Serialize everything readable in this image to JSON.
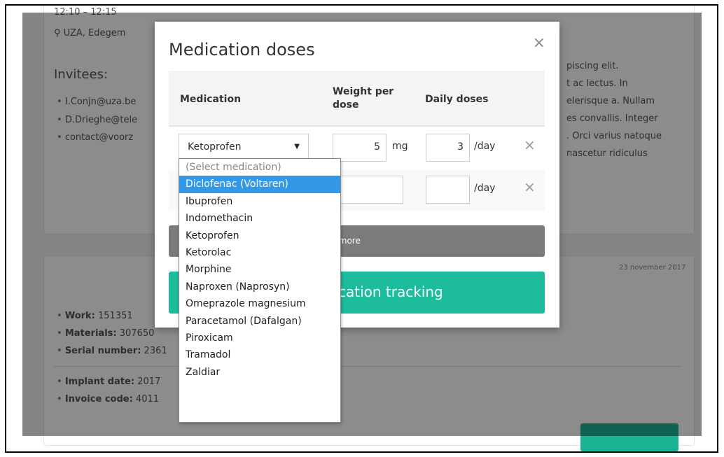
{
  "background": {
    "time_text": "12:10 – 12:15",
    "location_text": "UZA, Edegem",
    "invitees_heading": "Invitees:",
    "invitees": [
      "I.Conjn@uza.be",
      "D.Drieghe@tele",
      "contact@voorz"
    ],
    "lorem_lines": [
      "piscing elit.",
      "t ac lectus. In",
      "elerisque a. Nullam",
      "es convallis. Integer",
      ". Orci varius natoque",
      "nascetur ridiculus"
    ],
    "date_text": "23 november 2017",
    "details": [
      {
        "label": "Work:",
        "value": "151351"
      },
      {
        "label": "Materials:",
        "value": "307650"
      },
      {
        "label": "Serial number:",
        "value": "2361"
      }
    ],
    "details2": [
      {
        "label": "Implant date:",
        "value": "2017"
      },
      {
        "label": "Invoice code:",
        "value": "4011"
      }
    ]
  },
  "modal": {
    "title": "Medication doses",
    "close_icon": "×",
    "columns": {
      "medication": "Medication",
      "weight_line1": "Weight per",
      "weight_line2": "dose",
      "daily": "Daily doses"
    },
    "rows": [
      {
        "medication": "Ketoprofen",
        "weight": "5",
        "weight_unit": "mg",
        "daily": "3",
        "daily_unit": "/day"
      },
      {
        "medication": "",
        "weight": "",
        "weight_unit": "",
        "daily": "",
        "daily_unit": "/day"
      }
    ],
    "remove_icon": "×",
    "add_more_label": "ld more",
    "start_label": "cation tracking"
  },
  "dropdown": {
    "options": [
      "(Select medication)",
      "Diclofenac (Voltaren)",
      "Ibuprofen",
      "Indomethacin",
      "Ketoprofen",
      "Ketorolac",
      "Morphine",
      "Naproxen (Naprosyn)",
      "Omeprazole magnesium",
      "Paracetamol (Dafalgan)",
      "Piroxicam",
      "Tramadol",
      "Zaldiar"
    ],
    "highlighted": "Diclofenac (Voltaren)"
  },
  "colors": {
    "accent": "#1cbc9c",
    "highlight": "#3399e6",
    "add_more_bg": "#7b7b7b"
  }
}
